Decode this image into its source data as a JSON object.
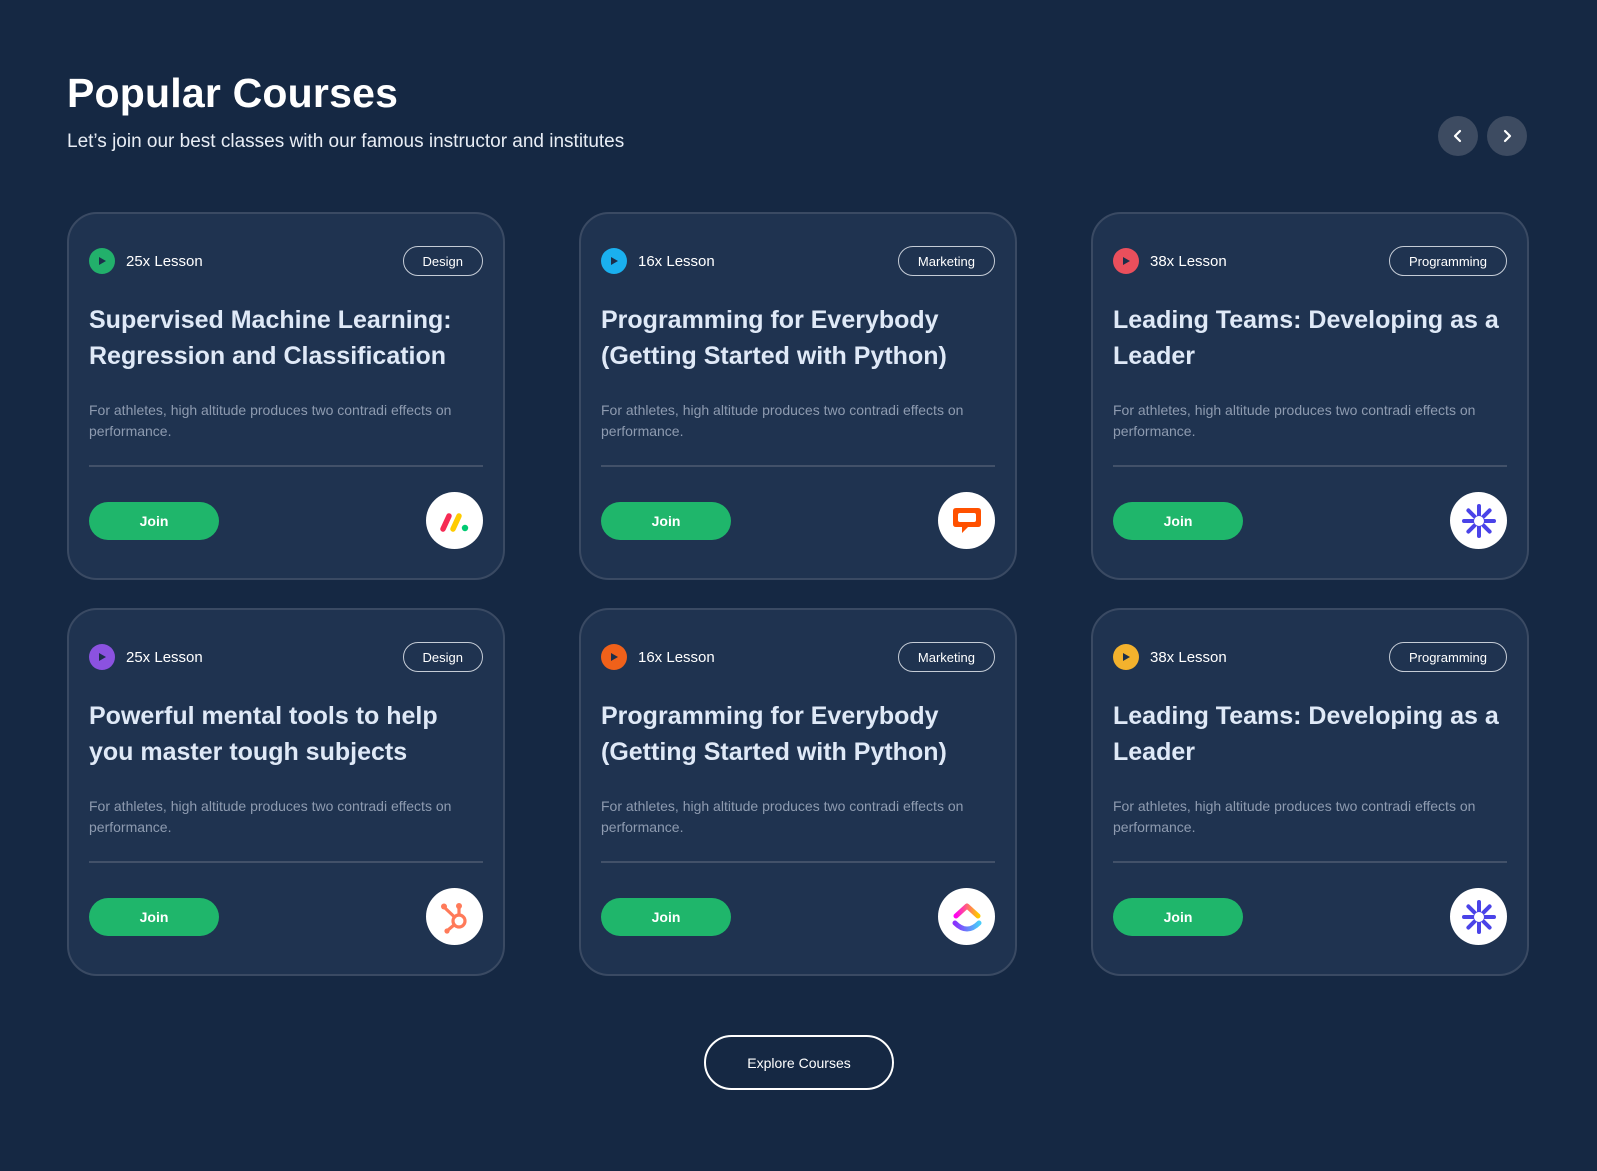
{
  "header": {
    "title": "Popular Courses",
    "subtitle": "Let’s join our best classes with our famous instructor and institutes"
  },
  "carousel": {
    "prev_icon": "chevron-left-icon",
    "next_icon": "chevron-right-icon"
  },
  "courses": [
    {
      "lessons": "25x Lesson",
      "tag": "Design",
      "title": "Supervised Machine Learning: Regression and Classification",
      "description": "For athletes, high altitude produces two contradi effects on performance.",
      "join_label": "Join",
      "dot_color": "#22b06b",
      "logo": "monday-logo"
    },
    {
      "lessons": "16x Lesson",
      "tag": "Marketing",
      "title": "Programming for Everybody (Getting Started with Python)",
      "description": "For athletes, high altitude produces two contradi effects on performance.",
      "join_label": "Join",
      "dot_color": "#1ab0ef",
      "logo": "livechat-logo"
    },
    {
      "lessons": "38x Lesson",
      "tag": "Programming",
      "title": "Leading Teams: Developing as a Leader",
      "description": "For athletes, high altitude produces two contradi effects on performance.",
      "join_label": "Join",
      "dot_color": "#ea4f5c",
      "logo": "zapier-logo"
    },
    {
      "lessons": "25x Lesson",
      "tag": "Design",
      "title": "Powerful mental tools to help you master tough subjects",
      "description": "For athletes, high altitude produces two contradi effects on performance.",
      "join_label": "Join",
      "dot_color": "#8b52e0",
      "logo": "hubspot-logo"
    },
    {
      "lessons": "16x Lesson",
      "tag": "Marketing",
      "title": "Programming for Everybody (Getting Started with Python)",
      "description": "For athletes, high altitude produces two contradi effects on performance.",
      "join_label": "Join",
      "dot_color": "#f0611a",
      "logo": "clickup-logo"
    },
    {
      "lessons": "38x Lesson",
      "tag": "Programming",
      "title": "Leading Teams: Developing as a Leader",
      "description": "For athletes, high altitude produces two contradi effects on performance.",
      "join_label": "Join",
      "dot_color": "#f3b22d",
      "logo": "zapier-logo"
    }
  ],
  "explore_label": "Explore Courses",
  "colors": {
    "background": "#152843",
    "card": "#1f3350",
    "accent_green": "#1fb66b"
  }
}
